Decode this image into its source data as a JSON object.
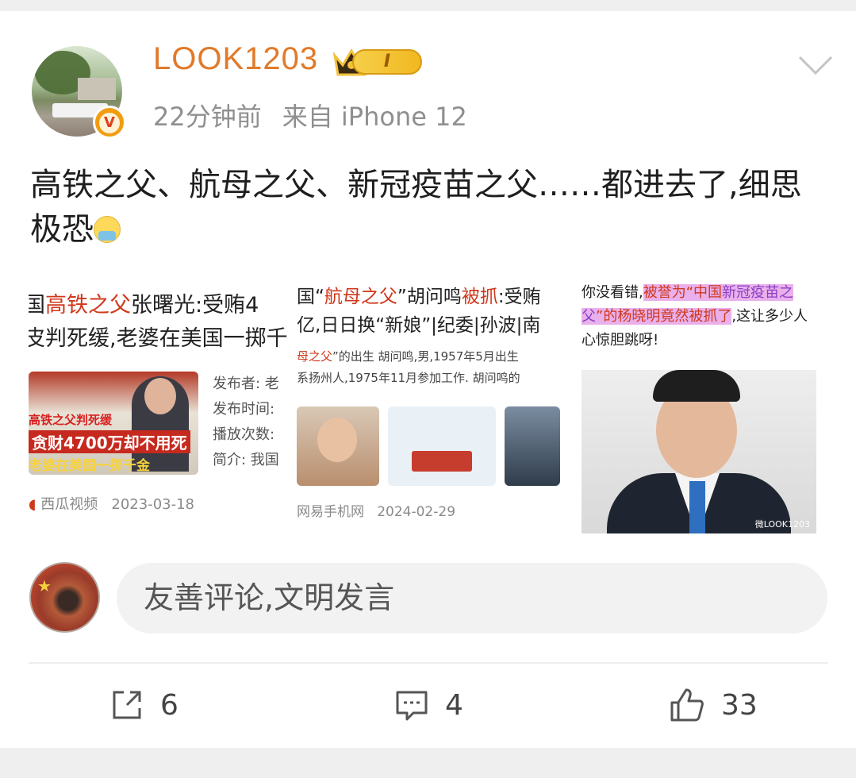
{
  "post": {
    "username": "LOOK1203",
    "member_badge": "I",
    "verified_mark": "V",
    "time": "22分钟前",
    "source": "来自 iPhone 12",
    "text_main": "高铁之父、航母之父、新冠疫苗之父……都进去了,细思极恐"
  },
  "images": {
    "panel1": {
      "title_pre": "国",
      "title_highlight": "高铁之父",
      "title_post": "张曙光:受贿4",
      "line2": "皮判死缓,老婆在美国一掷千",
      "thumb_cap1": "高铁之父判死缓",
      "thumb_cap2": "贪财4700万却不用死",
      "thumb_cap3": "老婆在美国一掷千金",
      "info_lines": [
        "发布者: 老",
        "发布时间:",
        "播放次数:",
        "简介: 我国"
      ],
      "source": "西瓜视频",
      "date": "2023-03-18"
    },
    "panel2": {
      "title_pre": "国“",
      "title_highlight": "航母之父",
      "title_mid": "”胡问鸣",
      "title_highlight2": "被抓",
      "title_post": ":受贿",
      "line2": "亿,日日换“新娘”|纪委|孙波|南",
      "snippet_highlight": "母之父",
      "snippet_line1": "”的出生 胡问鸣,男,1957年5月出生",
      "snippet_line2": "系扬州人,1975年11月参加工作. 胡问鸣的",
      "source": "网易手机网",
      "date": "2024-02-29"
    },
    "panel3": {
      "text_pre": "你没看错,",
      "hl1": "被誉为“中国",
      "hl2": "新冠疫",
      "hl3": "苗之父",
      "hl4": "”的杨晓明竟然被抓了",
      "text_post": ",这让多少人心惊胆跳呀!",
      "watermark": "微LOOK1203"
    }
  },
  "comment": {
    "placeholder": "友善评论,文明发言"
  },
  "actions": {
    "share_count": "6",
    "comment_count": "4",
    "like_count": "33"
  }
}
